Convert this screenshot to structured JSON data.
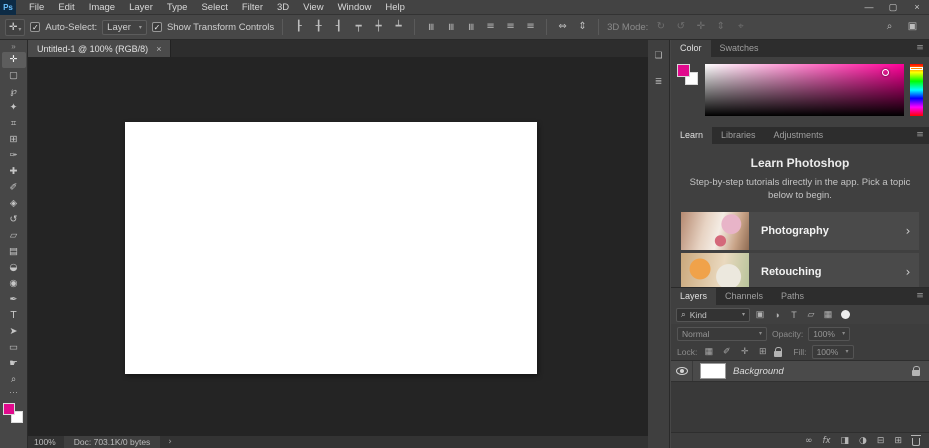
{
  "app": {
    "logo": "Ps",
    "window": {
      "minimize": "—",
      "restore": "▢",
      "close": "×"
    }
  },
  "menu": {
    "items": [
      "File",
      "Edit",
      "Image",
      "Layer",
      "Type",
      "Select",
      "Filter",
      "3D",
      "View",
      "Window",
      "Help"
    ]
  },
  "glyphs": {
    "check": "✓",
    "caret": "▾",
    "search": "⌕",
    "workspace": "▣",
    "panel_menu": "≡",
    "chevron_right": "›",
    "ellipsis": "⋯",
    "collapse": "»"
  },
  "options": {
    "auto_select_label": "Auto-Select:",
    "auto_select_value": "Layer",
    "show_transform_label": "Show Transform Controls",
    "mode_label": "3D Mode:",
    "align_icons": [
      {
        "name": "align-left-edges-icon",
        "glyph": "┠"
      },
      {
        "name": "align-horizontal-centers-icon",
        "glyph": "╂"
      },
      {
        "name": "align-right-edges-icon",
        "glyph": "┨"
      },
      {
        "name": "align-top-edges-icon",
        "glyph": "┯"
      },
      {
        "name": "align-vertical-centers-icon",
        "glyph": "┿"
      },
      {
        "name": "align-bottom-edges-icon",
        "glyph": "┷"
      }
    ],
    "distribute_icons": [
      {
        "name": "distribute-top-edges-icon",
        "glyph": "≡"
      },
      {
        "name": "distribute-vertical-centers-icon",
        "glyph": "≡"
      },
      {
        "name": "distribute-bottom-edges-icon",
        "glyph": "≡"
      },
      {
        "name": "distribute-left-edges-icon",
        "glyph": "≡"
      },
      {
        "name": "distribute-horizontal-centers-icon",
        "glyph": "≡"
      },
      {
        "name": "distribute-right-edges-icon",
        "glyph": "≡"
      }
    ],
    "spacing_icons": [
      {
        "name": "distribute-horizontal-spacing-icon",
        "glyph": "⇔"
      },
      {
        "name": "distribute-vertical-spacing-icon",
        "glyph": "⇕"
      }
    ],
    "mode_icons": [
      {
        "name": "3d-rotate-icon",
        "glyph": "↻"
      },
      {
        "name": "3d-roll-icon",
        "glyph": "↺"
      },
      {
        "name": "3d-pan-icon",
        "glyph": "✛"
      },
      {
        "name": "3d-slide-icon",
        "glyph": "⇕"
      },
      {
        "name": "3d-scale-icon",
        "glyph": "⌖"
      }
    ]
  },
  "toolbar": {
    "tools": [
      {
        "name": "move-tool",
        "glyph": "✛"
      },
      {
        "name": "rectangular-marquee-tool",
        "glyph": "▢"
      },
      {
        "name": "lasso-tool",
        "glyph": "℘"
      },
      {
        "name": "quick-selection-tool",
        "glyph": "✦"
      },
      {
        "name": "crop-tool",
        "glyph": "⌗"
      },
      {
        "name": "frame-tool",
        "glyph": "⊞"
      },
      {
        "name": "eyedropper-tool",
        "glyph": "✑"
      },
      {
        "name": "healing-brush-tool",
        "glyph": "✚"
      },
      {
        "name": "brush-tool",
        "glyph": "✐"
      },
      {
        "name": "clone-stamp-tool",
        "glyph": "◈"
      },
      {
        "name": "history-brush-tool",
        "glyph": "↺"
      },
      {
        "name": "eraser-tool",
        "glyph": "▱"
      },
      {
        "name": "gradient-tool",
        "glyph": "▤"
      },
      {
        "name": "blur-tool",
        "glyph": "◒"
      },
      {
        "name": "dodge-tool",
        "glyph": "◉"
      },
      {
        "name": "pen-tool",
        "glyph": "✒"
      },
      {
        "name": "type-tool",
        "glyph": "T"
      },
      {
        "name": "path-selection-tool",
        "glyph": "➤"
      },
      {
        "name": "rectangle-tool",
        "glyph": "▭"
      },
      {
        "name": "hand-tool",
        "glyph": "☛"
      },
      {
        "name": "zoom-tool",
        "glyph": "⌕"
      }
    ]
  },
  "document": {
    "tab_title": "Untitled-1 @ 100% (RGB/8)",
    "close_glyph": "×"
  },
  "status": {
    "zoom": "100%",
    "doc_info": "Doc: 703.1K/0 bytes"
  },
  "colors": {
    "foreground": "#e10a8d",
    "background": "#ffffff"
  },
  "mini_dock": {
    "icons": [
      {
        "name": "collapsed-panel-icon-1",
        "glyph": "❏"
      },
      {
        "name": "collapsed-panel-icon-2",
        "glyph": "≣"
      }
    ]
  },
  "panels": {
    "color": {
      "tabs": [
        "Color",
        "Swatches"
      ]
    },
    "learn": {
      "tabs": [
        "Learn",
        "Libraries",
        "Adjustments"
      ],
      "title": "Learn Photoshop",
      "description": "Step-by-step tutorials directly in the app. Pick a topic below to begin.",
      "topics": [
        {
          "label": "Photography"
        },
        {
          "label": "Retouching"
        }
      ]
    },
    "layers": {
      "tabs": [
        "Layers",
        "Channels",
        "Paths"
      ],
      "filter_label": "Kind",
      "blend_mode": "Normal",
      "opacity_label": "Opacity:",
      "opacity_value": "100%",
      "lock_label": "Lock:",
      "fill_label": "Fill:",
      "fill_value": "100%",
      "filter_icons": [
        {
          "name": "filter-pixel-layers-icon",
          "glyph": "▣"
        },
        {
          "name": "filter-adjustment-layers-icon",
          "glyph": "◑"
        },
        {
          "name": "filter-type-layers-icon",
          "glyph": "T"
        },
        {
          "name": "filter-shape-layers-icon",
          "glyph": "▱"
        },
        {
          "name": "filter-smart-objects-icon",
          "glyph": "▦"
        }
      ],
      "lock_icons": [
        {
          "name": "lock-transparency-icon",
          "glyph": "▦"
        },
        {
          "name": "lock-image-icon",
          "glyph": "✐"
        },
        {
          "name": "lock-position-icon",
          "glyph": "✛"
        },
        {
          "name": "lock-artboards-icon",
          "glyph": "⊞"
        }
      ],
      "rows": [
        {
          "name": "Background"
        }
      ],
      "bottom_icons": [
        {
          "name": "link-layers-icon",
          "glyph": "∞"
        },
        {
          "name": "layer-effects-icon",
          "glyph": "fx"
        },
        {
          "name": "add-layer-mask-icon",
          "glyph": "◨"
        },
        {
          "name": "new-adjustment-layer-icon",
          "glyph": "◑"
        },
        {
          "name": "new-group-icon",
          "glyph": "⊟"
        },
        {
          "name": "new-layer-icon",
          "glyph": "⊞"
        }
      ]
    }
  }
}
